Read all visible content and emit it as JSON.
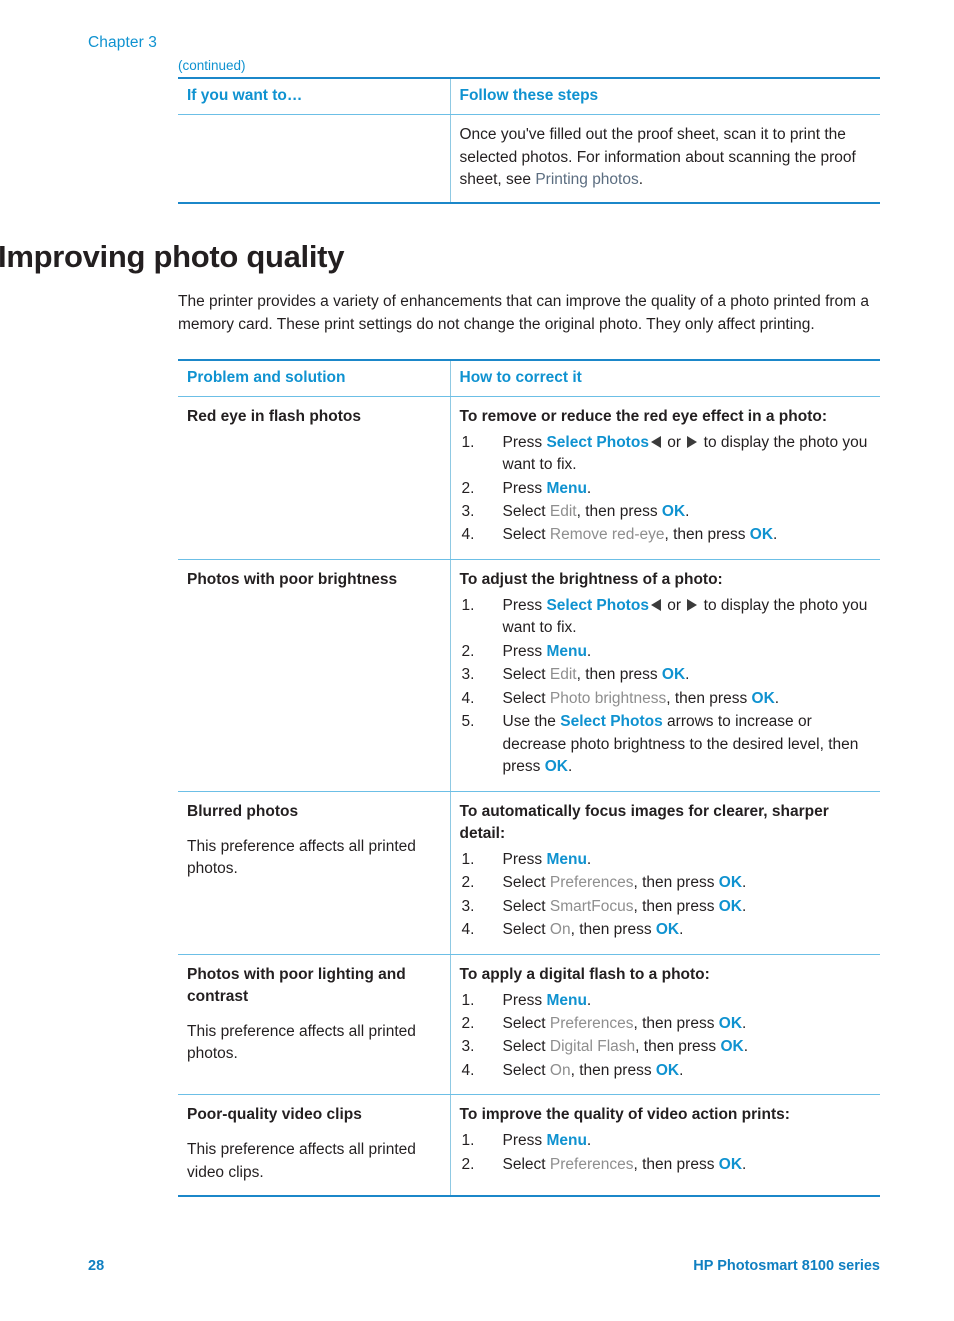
{
  "header": {
    "chapter": "Chapter 3"
  },
  "continued_label": "(continued)",
  "table1": {
    "headers": [
      "If you want to…",
      "Follow these steps"
    ],
    "rows": [
      {
        "left": "",
        "right_prefix": "Once you've filled out the proof sheet, scan it to print the selected photos. For information about scanning the proof sheet, see ",
        "right_link": "Printing photos",
        "right_suffix": "."
      }
    ]
  },
  "section": {
    "title": "Improving photo quality",
    "intro": "The printer provides a variety of enhancements that can improve the quality of a photo printed from a memory card. These print settings do not change the original photo. They only affect printing."
  },
  "table2": {
    "headers": [
      "Problem and solution",
      "How to correct it"
    ],
    "rows": [
      {
        "problem_title": "Red eye in flash photos",
        "problem_note": "",
        "solution_title": "To remove or reduce the red eye effect in a photo:",
        "steps": [
          {
            "parts": [
              {
                "t": "text",
                "v": "Press "
              },
              {
                "t": "btn",
                "v": "Select Photos"
              },
              {
                "t": "arrow-left",
                "v": "left-arrow-icon"
              },
              {
                "t": "text",
                "v": " or "
              },
              {
                "t": "arrow-right",
                "v": "right-arrow-icon"
              },
              {
                "t": "text",
                "v": " to display the photo you want to fix."
              }
            ]
          },
          {
            "parts": [
              {
                "t": "text",
                "v": "Press "
              },
              {
                "t": "btn",
                "v": "Menu"
              },
              {
                "t": "text",
                "v": "."
              }
            ]
          },
          {
            "parts": [
              {
                "t": "text",
                "v": "Select "
              },
              {
                "t": "menuitem",
                "v": "Edit"
              },
              {
                "t": "text",
                "v": ", then press "
              },
              {
                "t": "btn",
                "v": "OK"
              },
              {
                "t": "text",
                "v": "."
              }
            ]
          },
          {
            "parts": [
              {
                "t": "text",
                "v": "Select "
              },
              {
                "t": "menuitem",
                "v": "Remove red-eye"
              },
              {
                "t": "text",
                "v": ", then press "
              },
              {
                "t": "btn",
                "v": "OK"
              },
              {
                "t": "text",
                "v": "."
              }
            ]
          }
        ]
      },
      {
        "problem_title": "Photos with poor brightness",
        "problem_note": "",
        "solution_title": "To adjust the brightness of a photo:",
        "steps": [
          {
            "parts": [
              {
                "t": "text",
                "v": "Press "
              },
              {
                "t": "btn",
                "v": "Select Photos"
              },
              {
                "t": "arrow-left",
                "v": "left-arrow-icon"
              },
              {
                "t": "text",
                "v": " or "
              },
              {
                "t": "arrow-right",
                "v": "right-arrow-icon"
              },
              {
                "t": "text",
                "v": " to display the photo you want to fix."
              }
            ]
          },
          {
            "parts": [
              {
                "t": "text",
                "v": "Press "
              },
              {
                "t": "btn",
                "v": "Menu"
              },
              {
                "t": "text",
                "v": "."
              }
            ]
          },
          {
            "parts": [
              {
                "t": "text",
                "v": "Select "
              },
              {
                "t": "menuitem",
                "v": "Edit"
              },
              {
                "t": "text",
                "v": ", then press "
              },
              {
                "t": "btn",
                "v": "OK"
              },
              {
                "t": "text",
                "v": "."
              }
            ]
          },
          {
            "parts": [
              {
                "t": "text",
                "v": "Select "
              },
              {
                "t": "menuitem",
                "v": "Photo brightness"
              },
              {
                "t": "text",
                "v": ", then press "
              },
              {
                "t": "btn",
                "v": "OK"
              },
              {
                "t": "text",
                "v": "."
              }
            ]
          },
          {
            "parts": [
              {
                "t": "text",
                "v": "Use the "
              },
              {
                "t": "btn",
                "v": "Select Photos"
              },
              {
                "t": "text",
                "v": " arrows to increase or decrease photo brightness to the desired level, then press "
              },
              {
                "t": "btn",
                "v": "OK"
              },
              {
                "t": "text",
                "v": "."
              }
            ]
          }
        ]
      },
      {
        "problem_title": "Blurred photos",
        "problem_note": "This preference affects all printed photos.",
        "solution_title": "To automatically focus images for clearer, sharper detail:",
        "steps": [
          {
            "parts": [
              {
                "t": "text",
                "v": "Press "
              },
              {
                "t": "btn",
                "v": "Menu"
              },
              {
                "t": "text",
                "v": "."
              }
            ]
          },
          {
            "parts": [
              {
                "t": "text",
                "v": "Select "
              },
              {
                "t": "menuitem",
                "v": "Preferences"
              },
              {
                "t": "text",
                "v": ", then press "
              },
              {
                "t": "btn",
                "v": "OK"
              },
              {
                "t": "text",
                "v": "."
              }
            ]
          },
          {
            "parts": [
              {
                "t": "text",
                "v": "Select "
              },
              {
                "t": "menuitem",
                "v": "SmartFocus"
              },
              {
                "t": "text",
                "v": ", then press "
              },
              {
                "t": "btn",
                "v": "OK"
              },
              {
                "t": "text",
                "v": "."
              }
            ]
          },
          {
            "parts": [
              {
                "t": "text",
                "v": "Select "
              },
              {
                "t": "menuitem",
                "v": "On"
              },
              {
                "t": "text",
                "v": ", then press "
              },
              {
                "t": "btn",
                "v": "OK"
              },
              {
                "t": "text",
                "v": "."
              }
            ]
          }
        ]
      },
      {
        "problem_title": "Photos with poor lighting and contrast",
        "problem_note": "This preference affects all printed photos.",
        "solution_title": "To apply a digital flash to a photo:",
        "steps": [
          {
            "parts": [
              {
                "t": "text",
                "v": "Press "
              },
              {
                "t": "btn",
                "v": "Menu"
              },
              {
                "t": "text",
                "v": "."
              }
            ]
          },
          {
            "parts": [
              {
                "t": "text",
                "v": "Select "
              },
              {
                "t": "menuitem",
                "v": "Preferences"
              },
              {
                "t": "text",
                "v": ", then press "
              },
              {
                "t": "btn",
                "v": "OK"
              },
              {
                "t": "text",
                "v": "."
              }
            ]
          },
          {
            "parts": [
              {
                "t": "text",
                "v": "Select "
              },
              {
                "t": "menuitem",
                "v": "Digital Flash"
              },
              {
                "t": "text",
                "v": ", then press "
              },
              {
                "t": "btn",
                "v": "OK"
              },
              {
                "t": "text",
                "v": "."
              }
            ]
          },
          {
            "parts": [
              {
                "t": "text",
                "v": "Select "
              },
              {
                "t": "menuitem",
                "v": "On"
              },
              {
                "t": "text",
                "v": ", then press "
              },
              {
                "t": "btn",
                "v": "OK"
              },
              {
                "t": "text",
                "v": "."
              }
            ]
          }
        ]
      },
      {
        "problem_title": "Poor-quality video clips",
        "problem_note": "This preference affects all printed video clips.",
        "solution_title": "To improve the quality of video action prints:",
        "steps": [
          {
            "parts": [
              {
                "t": "text",
                "v": "Press "
              },
              {
                "t": "btn",
                "v": "Menu"
              },
              {
                "t": "text",
                "v": "."
              }
            ]
          },
          {
            "parts": [
              {
                "t": "text",
                "v": "Select "
              },
              {
                "t": "menuitem",
                "v": "Preferences"
              },
              {
                "t": "text",
                "v": ", then press "
              },
              {
                "t": "btn",
                "v": "OK"
              },
              {
                "t": "text",
                "v": "."
              }
            ]
          }
        ]
      }
    ]
  },
  "footer": {
    "page_number": "28",
    "product": "HP Photosmart 8100 series"
  },
  "colors": {
    "accent_blue": "#0f92d0",
    "rule_blue": "#1b87c9",
    "rule_light_blue": "#6cbfe6",
    "menu_gray": "#8e8e8e",
    "xref_slate": "#5b6d80",
    "body_black": "#231f20"
  }
}
